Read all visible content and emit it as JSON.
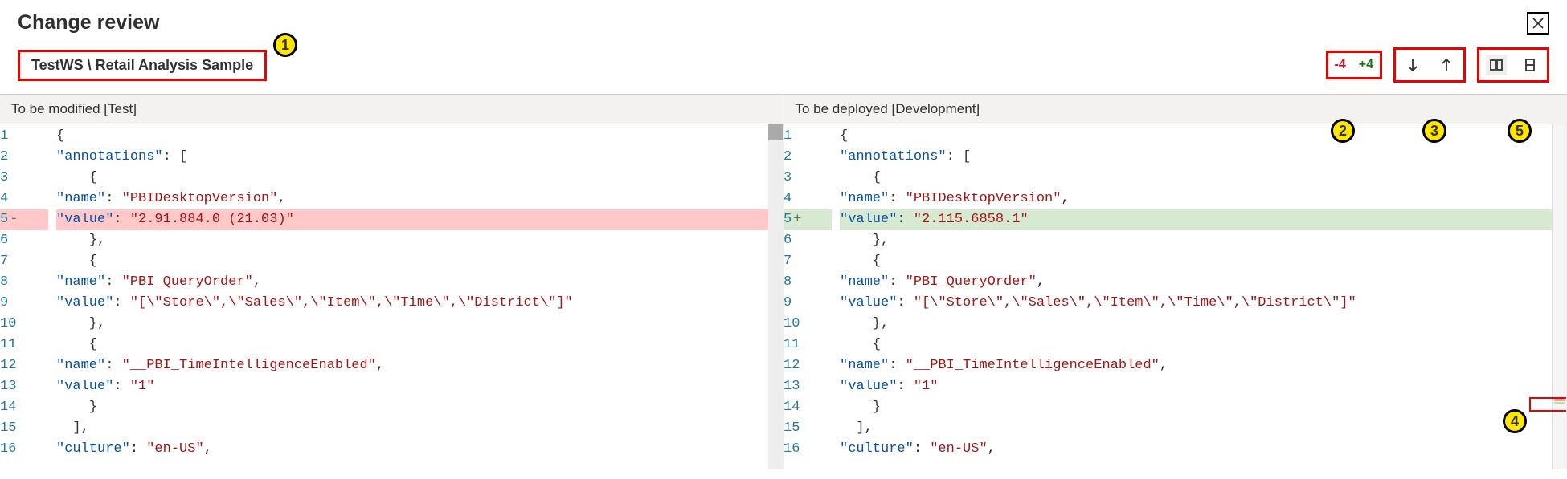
{
  "title": "Change review",
  "breadcrumb": "TestWS \\ Retail Analysis Sample",
  "callouts": {
    "c1": "1",
    "c2": "2",
    "c3": "3",
    "c4": "4",
    "c5": "5"
  },
  "counts": {
    "removed": "-4",
    "added": "+4"
  },
  "pane_headers": {
    "left": "To be modified [Test]",
    "right": "To be deployed [Development]"
  },
  "icons": {
    "close": "close-icon",
    "arrow_down": "arrow-down-icon",
    "arrow_up": "arrow-up-icon",
    "side_by_side": "side-by-side-view-icon",
    "inline": "inline-view-icon"
  },
  "chart_data": {
    "type": "table",
    "left_file_label": "To be modified [Test]",
    "right_file_label": "To be deployed [Development]",
    "lines": [
      {
        "num": "1",
        "marker": "",
        "type": "context",
        "content": "{"
      },
      {
        "num": "2",
        "marker": "",
        "type": "context",
        "content": "  \"annotations\": ["
      },
      {
        "num": "3",
        "marker": "",
        "type": "context",
        "content": "    {"
      },
      {
        "num": "4",
        "marker": "",
        "type": "context",
        "content": "      \"name\": \"PBIDesktopVersion\","
      },
      {
        "num": "5",
        "marker_left": "-",
        "marker_right": "+",
        "type": "changed",
        "left": "      \"value\": \"2.91.884.0 (21.03)\"",
        "right": "      \"value\": \"2.115.6858.1\""
      },
      {
        "num": "6",
        "marker": "",
        "type": "context",
        "content": "    },"
      },
      {
        "num": "7",
        "marker": "",
        "type": "context",
        "content": "    {"
      },
      {
        "num": "8",
        "marker": "",
        "type": "context",
        "content": "      \"name\": \"PBI_QueryOrder\","
      },
      {
        "num": "9",
        "marker": "",
        "type": "context",
        "content": "      \"value\": \"[\\\"Store\\\",\\\"Sales\\\",\\\"Item\\\",\\\"Time\\\",\\\"District\\\"]\""
      },
      {
        "num": "10",
        "marker": "",
        "type": "context",
        "content": "    },"
      },
      {
        "num": "11",
        "marker": "",
        "type": "context",
        "content": "    {"
      },
      {
        "num": "12",
        "marker": "",
        "type": "context",
        "content": "      \"name\": \"__PBI_TimeIntelligenceEnabled\","
      },
      {
        "num": "13",
        "marker": "",
        "type": "context",
        "content": "      \"value\": \"1\""
      },
      {
        "num": "14",
        "marker": "",
        "type": "context",
        "content": "    }"
      },
      {
        "num": "15",
        "marker": "",
        "type": "context",
        "content": "  ],"
      },
      {
        "num": "16",
        "marker": "",
        "type": "context",
        "content": "  \"culture\": \"en-US\","
      }
    ]
  }
}
